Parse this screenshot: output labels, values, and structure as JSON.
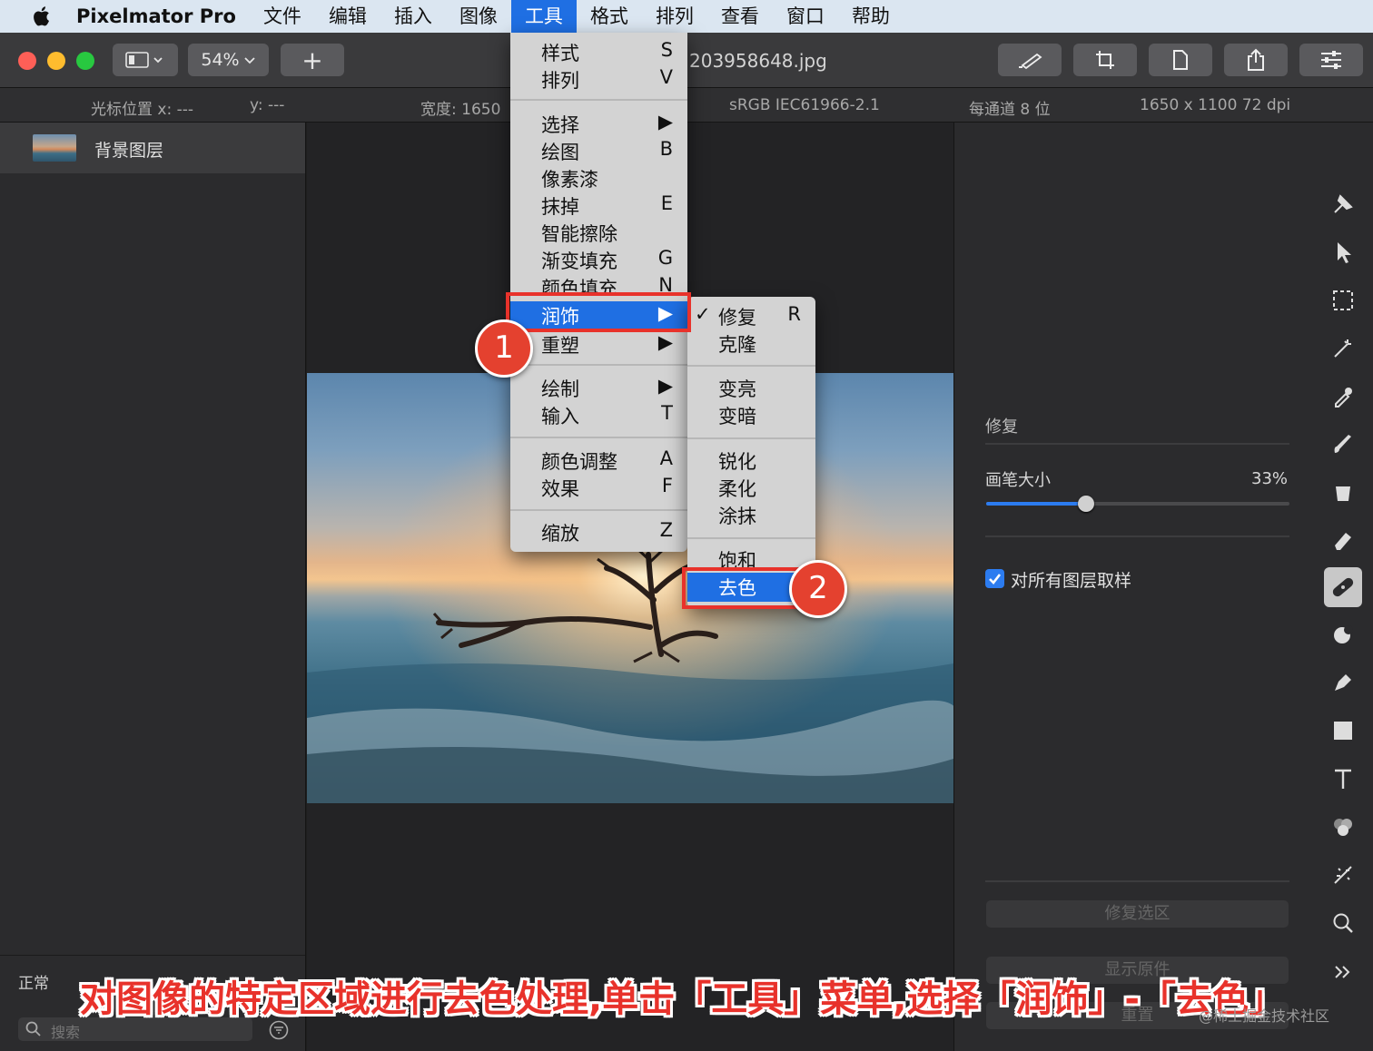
{
  "menubar": {
    "app_name": "Pixelmator Pro",
    "items": [
      "文件",
      "编辑",
      "插入",
      "图像",
      "工具",
      "格式",
      "排列",
      "查看",
      "窗口",
      "帮助"
    ],
    "active_item": "工具"
  },
  "toolbar": {
    "zoom_label": "54%",
    "add_label": "+",
    "document_title": "203958648.jpg"
  },
  "infobar": {
    "cursor_x": "光标位置 x: ---",
    "cursor_y": "y: ---",
    "width": "宽度: 1650",
    "color_profile": "sRGB IEC61966-2.1",
    "bit_depth": "每通道 8 位",
    "dimensions": "1650 x 1100 72 dpi"
  },
  "layers": {
    "items": [
      {
        "name": "背景图层"
      }
    ],
    "blend_mode": "正常",
    "search_placeholder": "搜索"
  },
  "tools_menu": {
    "items": [
      {
        "label": "样式",
        "shortcut": "S"
      },
      {
        "label": "排列",
        "shortcut": "V"
      },
      {
        "label": "选择",
        "shortcut": "▶"
      },
      {
        "label": "绘图",
        "shortcut": "B"
      },
      {
        "label": "像素漆",
        "shortcut": ""
      },
      {
        "label": "抹掉",
        "shortcut": "E"
      },
      {
        "label": "智能擦除",
        "shortcut": ""
      },
      {
        "label": "渐变填充",
        "shortcut": "G"
      },
      {
        "label": "颜色填充",
        "shortcut": "N"
      },
      {
        "label": "润饰",
        "shortcut": "▶"
      },
      {
        "label": "重塑",
        "shortcut": "▶"
      },
      {
        "label": "绘制",
        "shortcut": "▶"
      },
      {
        "label": "输入",
        "shortcut": "T"
      },
      {
        "label": "颜色调整",
        "shortcut": "A"
      },
      {
        "label": "效果",
        "shortcut": "F"
      },
      {
        "label": "缩放",
        "shortcut": "Z"
      }
    ]
  },
  "retouch_menu": {
    "check_mark": "✓",
    "items": [
      {
        "label": "修复",
        "shortcut": "R"
      },
      {
        "label": "克隆",
        "shortcut": ""
      },
      {
        "label": "变亮",
        "shortcut": ""
      },
      {
        "label": "变暗",
        "shortcut": ""
      },
      {
        "label": "锐化",
        "shortcut": ""
      },
      {
        "label": "柔化",
        "shortcut": ""
      },
      {
        "label": "涂抹",
        "shortcut": ""
      },
      {
        "label": "饱和",
        "shortcut": ""
      },
      {
        "label": "去色",
        "shortcut": ""
      }
    ]
  },
  "tool_options": {
    "title": "修复",
    "brush_size_label": "画笔大小",
    "brush_size_value": "33%",
    "brush_size_fraction": 0.33,
    "sample_all_layers_label": "对所有图层取样",
    "sample_all_layers_checked": true,
    "repair_selection_label": "修复选区",
    "show_original_label": "显示原件",
    "reset_label": "重置"
  },
  "tool_strip": [
    "arrange-icon",
    "cursor-icon",
    "selection-icon",
    "magic-wand-icon",
    "color-picker-icon",
    "brush-icon",
    "fill-bucket-icon",
    "eraser-icon",
    "retouch-bandage-icon",
    "reshape-icon",
    "pen-icon",
    "shape-icon",
    "type-icon",
    "color-adjust-icon",
    "effects-icon",
    "zoom-icon",
    "more-icon"
  ],
  "annotations": {
    "step1": "1",
    "step2": "2",
    "caption": "对图像的特定区域进行去色处理,单击「工具」菜单,选择「润饰」-「去色」",
    "watermark": "@稀土掘金技术社区"
  },
  "colors": {
    "accent": "#1f6fe3",
    "annotation_red": "#e8322b"
  }
}
